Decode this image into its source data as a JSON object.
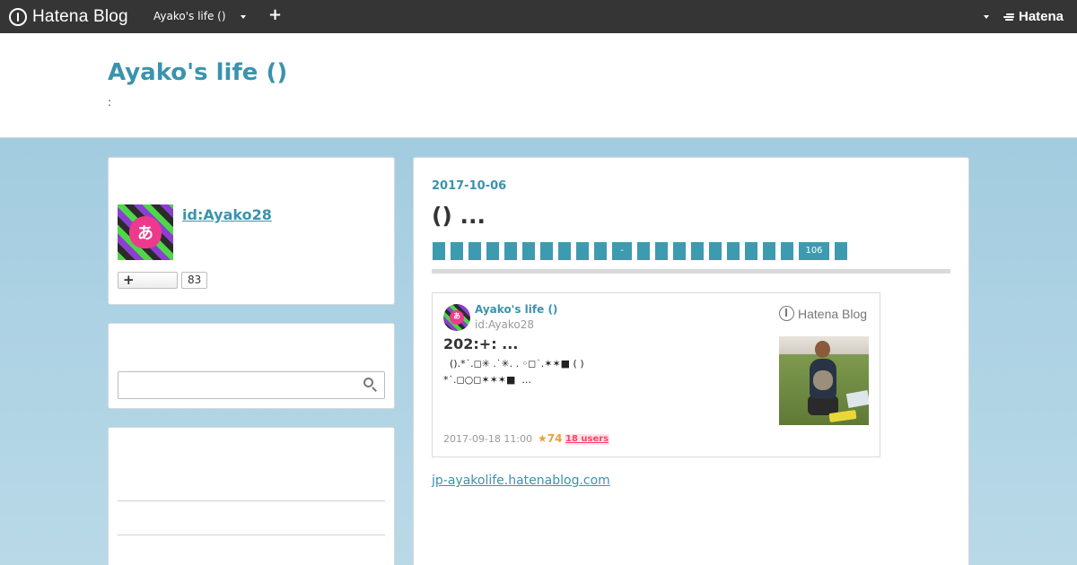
{
  "topbar": {
    "brand": "Hatena Blog",
    "blog_name": "Ayako's life ()",
    "add_label": "+",
    "right_brand": "Hatena"
  },
  "header": {
    "title": "Ayako's life ()",
    "description": ":"
  },
  "profile": {
    "id": "id:Ayako28",
    "avatar_glyph": "あ",
    "follow_label": "+",
    "follower_count": "83"
  },
  "search": {
    "placeholder": ""
  },
  "entry": {
    "date": "2017-10-06",
    "title": "() ...",
    "tags": [
      "",
      "",
      "",
      "",
      "",
      "",
      "",
      "",
      "",
      "",
      "-",
      "",
      "",
      "",
      "",
      "",
      "",
      "",
      "",
      "",
      "106",
      ""
    ],
    "url": "jp-ayakolife.hatenablog.com"
  },
  "embed": {
    "blog_name": "Ayako's life ()",
    "id": "id:Ayako28",
    "logo": "Hatena Blog",
    "title": "202:+: ...",
    "text_line1": "  ().*˙.◻✳ .˙✳. . ◦◻˙.✶✶■ ( )",
    "text_line2": "*˙.◻○◻✶✶✶■  ...",
    "avatar_glyph": "あ",
    "date": "2017-09-18 11:00",
    "stars": "★74",
    "users": "18 users"
  },
  "colors": {
    "accent": "#3b93ad",
    "topbar": "#353535",
    "tag": "#3d9bb0",
    "star": "#e8a23a",
    "bookmark": "#ff4166"
  }
}
